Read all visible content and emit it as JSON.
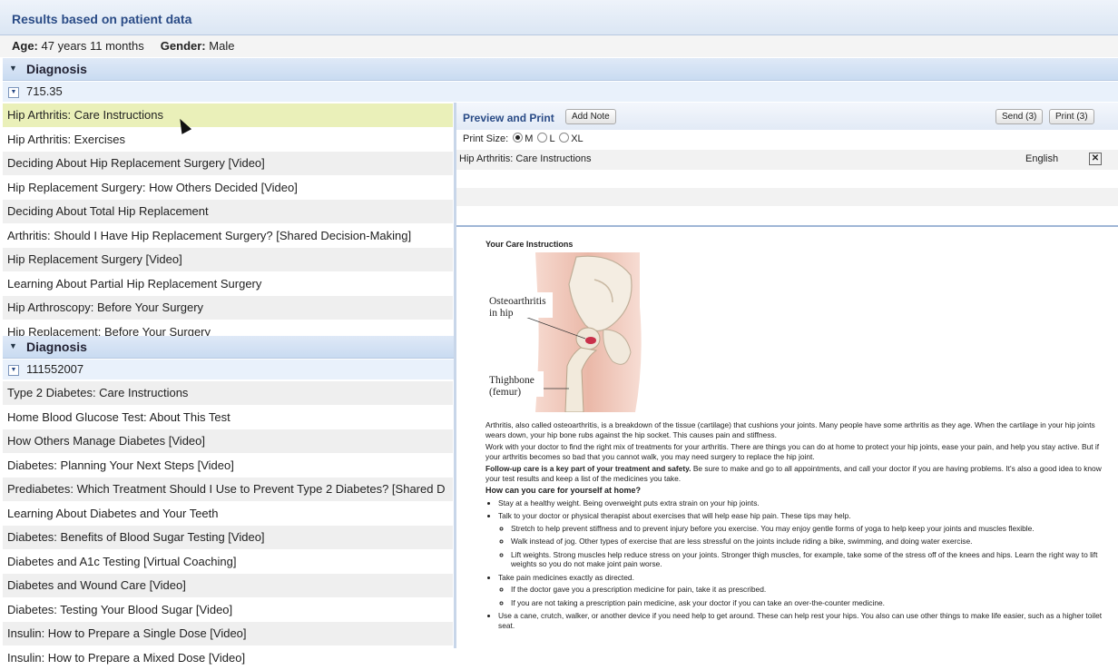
{
  "header": {
    "title": "Results based on patient data"
  },
  "patient": {
    "age_label": "Age:",
    "age_value": "47 years 11 months",
    "gender_label": "Gender:",
    "gender_value": "Male"
  },
  "diagnoses": [
    {
      "label": "Diagnosis",
      "code": "715.35",
      "items": [
        "Hip Arthritis: Care Instructions",
        "Hip Arthritis: Exercises",
        "Deciding About Hip Replacement Surgery [Video]",
        "Hip Replacement Surgery: How Others Decided [Video]",
        "Deciding About Total Hip Replacement",
        "Arthritis: Should I Have Hip Replacement Surgery? [Shared Decision-Making]",
        "Hip Replacement Surgery [Video]",
        "Learning About Partial Hip Replacement Surgery",
        "Hip Arthroscopy: Before Your Surgery",
        "Hip Replacement: Before Your Surgery"
      ]
    },
    {
      "label": "Diagnosis",
      "code": "111552007",
      "items": [
        "Type 2 Diabetes: Care Instructions",
        "Home Blood Glucose Test: About This Test",
        "How Others Manage Diabetes [Video]",
        "Diabetes: Planning Your Next Steps [Video]",
        "Prediabetes: Which Treatment Should I Use to Prevent Type 2 Diabetes? [Shared D",
        "Learning About Diabetes and Your Teeth",
        "Diabetes: Benefits of Blood Sugar Testing [Video]",
        "Diabetes and A1c Testing [Virtual Coaching]",
        "Diabetes and Wound Care [Video]",
        "Diabetes: Testing Your Blood Sugar [Video]",
        "Insulin: How to Prepare a Single Dose [Video]",
        "Insulin: How to Prepare a Mixed Dose [Video]"
      ]
    }
  ],
  "preview": {
    "title": "Preview and Print",
    "add_note": "Add Note",
    "send": "Send (3)",
    "print": "Print (3)",
    "print_size_label": "Print Size:",
    "sizes": [
      "M",
      "L",
      "XL"
    ],
    "selected_size": "M",
    "doc_name": "Hip Arthritis: Care Instructions",
    "language": "English",
    "remove": "✕"
  },
  "document": {
    "heading": "Your Care Instructions",
    "illus_label1": "Osteoarthritis",
    "illus_label1b": "in hip",
    "illus_label2": "Thighbone",
    "illus_label2b": "(femur)",
    "p1": "Arthritis, also called osteoarthritis, is a breakdown of the tissue (cartilage) that cushions your joints. Many people have some arthritis as they age. When the cartilage in your hip joints wears down, your hip bone rubs against the hip socket. This causes pain and stiffness.",
    "p2": "Work with your doctor to find the right mix of treatments for your arthritis. There are things you can do at home to protect your hip joints, ease your pain, and help you stay active. But if your arthritis becomes so bad that you cannot walk, you may need surgery to replace the hip joint.",
    "p3_bold": "Follow-up care is a key part of your treatment and safety.",
    "p3_rest": " Be sure to make and go to all appointments, and call your doctor if you are having problems. It's also a good idea to know your test results and keep a list of the medicines you take.",
    "h2": "How can you care for yourself at home?",
    "b1": "Stay at a healthy weight. Being overweight puts extra strain on your hip joints.",
    "b2": "Talk to your doctor or physical therapist about exercises that will help ease hip pain. These tips may help.",
    "b2a": "Stretch to help prevent stiffness and to prevent injury before you exercise. You may enjoy gentle forms of yoga to help keep your joints and muscles flexible.",
    "b2b": "Walk instead of jog. Other types of exercise that are less stressful on the joints include riding a bike, swimming, and doing water exercise.",
    "b2c": "Lift weights. Strong muscles help reduce stress on your joints. Stronger thigh muscles, for example, take some of the stress off of the knees and hips. Learn the right way to lift weights so you do not make joint pain worse.",
    "b3": "Take pain medicines exactly as directed.",
    "b3a": "If the doctor gave you a prescription medicine for pain, take it as prescribed.",
    "b3b": "If you are not taking a prescription pain medicine, ask your doctor if you can take an over-the-counter medicine.",
    "b4": "Use a cane, crutch, walker, or another device if you need help to get around. These can help rest your hips. You also can use other things to make life easier, such as a higher toilet seat."
  }
}
